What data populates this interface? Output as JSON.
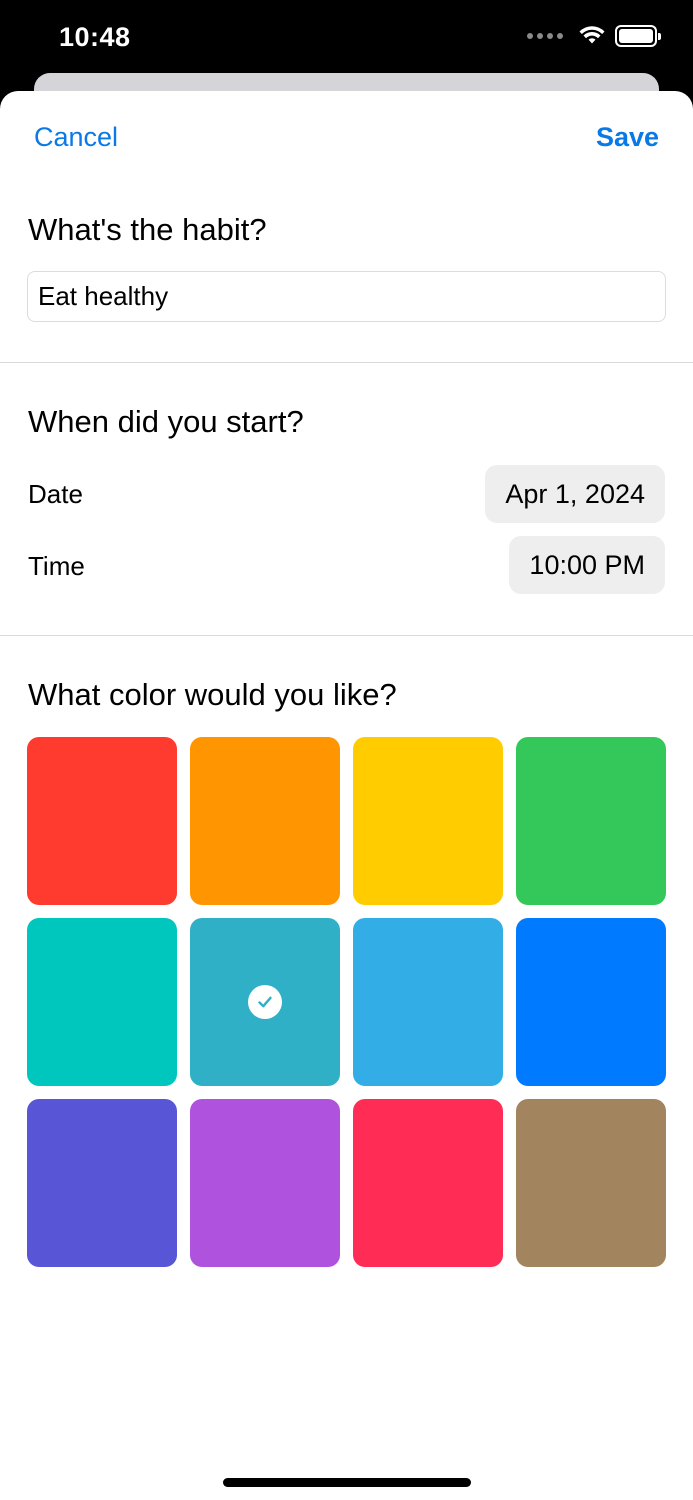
{
  "status_bar": {
    "time": "10:48"
  },
  "nav": {
    "cancel_label": "Cancel",
    "save_label": "Save"
  },
  "habit": {
    "title": "What's the habit?",
    "value": "Eat healthy"
  },
  "start": {
    "title": "When did you start?",
    "date_label": "Date",
    "date_value": "Apr 1, 2024",
    "time_label": "Time",
    "time_value": "10:00 PM"
  },
  "color": {
    "title": "What color would you like?",
    "selected_index": 5,
    "swatches": [
      "#ff3b30",
      "#ff9500",
      "#ffcc00",
      "#34c759",
      "#00c7be",
      "#30b0c7",
      "#32ade6",
      "#007aff",
      "#5856d6",
      "#af52de",
      "#ff2d55",
      "#a2845e"
    ],
    "check_icon": "checkmark-circle-icon"
  }
}
